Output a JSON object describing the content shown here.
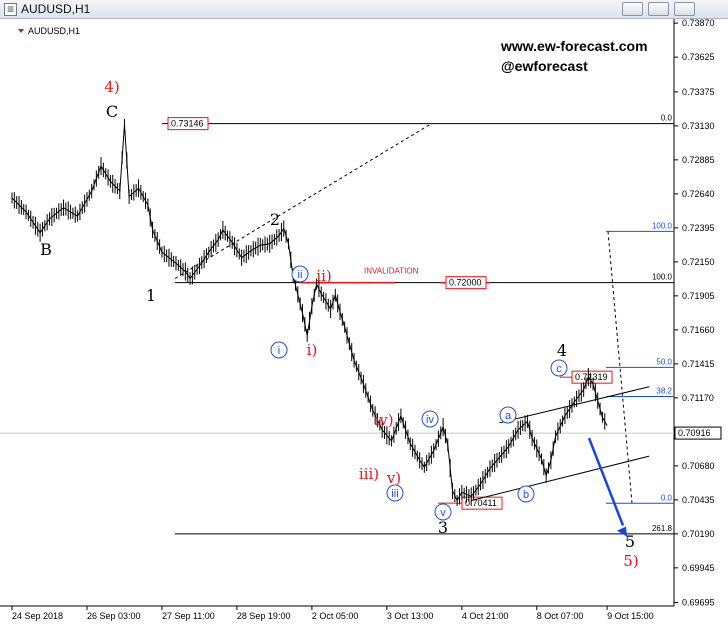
{
  "window": {
    "title": "AUDUSD,H1"
  },
  "chart_data": {
    "type": "line",
    "symbol": "AUDUSD,H1",
    "watermark": [
      "www.ew-forecast.com",
      "@ewforecast"
    ],
    "y_ticks": [
      "0.73870",
      "0.73625",
      "0.73375",
      "0.73130",
      "0.72885",
      "0.72640",
      "0.72395",
      "0.72150",
      "0.71905",
      "0.71660",
      "0.71415",
      "0.71170",
      "0.70925",
      "0.70680",
      "0.70435",
      "0.70190",
      "0.69945",
      "0.69695"
    ],
    "x_ticks": [
      "24 Sep 2018",
      "26 Sep 03:00",
      "27 Sep 11:00",
      "28 Sep 19:00",
      "2 Oct 05:00",
      "3 Oct 13:00",
      "4 Oct 21:00",
      "8 Oct 07:00",
      "9 Oct 15:00"
    ],
    "ylim": [
      0.6967,
      0.739
    ],
    "xlim": [
      0,
      140
    ],
    "price": [
      [
        0,
        0.7261
      ],
      [
        3,
        0.7251
      ],
      [
        6,
        0.7236
      ],
      [
        8,
        0.7246
      ],
      [
        11,
        0.7254
      ],
      [
        14,
        0.7248
      ],
      [
        17,
        0.7266
      ],
      [
        19,
        0.7284
      ],
      [
        21,
        0.7273
      ],
      [
        23,
        0.7266
      ],
      [
        24,
        0.7314
      ],
      [
        25,
        0.7262
      ],
      [
        27,
        0.7268
      ],
      [
        29,
        0.7256
      ],
      [
        30,
        0.7238
      ],
      [
        32,
        0.7222
      ],
      [
        35,
        0.7214
      ],
      [
        37,
        0.7208
      ],
      [
        38,
        0.7203
      ],
      [
        40,
        0.7212
      ],
      [
        42,
        0.7222
      ],
      [
        44,
        0.7231
      ],
      [
        45,
        0.7238
      ],
      [
        47,
        0.7229
      ],
      [
        49,
        0.7218
      ],
      [
        51,
        0.7223
      ],
      [
        53,
        0.7227
      ],
      [
        55,
        0.7228
      ],
      [
        57,
        0.7234
      ],
      [
        58,
        0.7239
      ],
      [
        59,
        0.7228
      ],
      [
        60,
        0.7205
      ],
      [
        62,
        0.7178
      ],
      [
        63,
        0.7162
      ],
      [
        64,
        0.7183
      ],
      [
        65,
        0.7199
      ],
      [
        66,
        0.7192
      ],
      [
        68,
        0.7181
      ],
      [
        69,
        0.7191
      ],
      [
        70,
        0.7179
      ],
      [
        71,
        0.7168
      ],
      [
        73,
        0.7144
      ],
      [
        75,
        0.7127
      ],
      [
        77,
        0.7108
      ],
      [
        79,
        0.7094
      ],
      [
        81,
        0.7086
      ],
      [
        83,
        0.7104
      ],
      [
        84,
        0.7094
      ],
      [
        85,
        0.7084
      ],
      [
        87,
        0.7072
      ],
      [
        88,
        0.7067
      ],
      [
        90,
        0.7079
      ],
      [
        92,
        0.7096
      ],
      [
        93,
        0.7083
      ],
      [
        94,
        0.705
      ],
      [
        95,
        0.7043
      ],
      [
        96,
        0.7049
      ],
      [
        98,
        0.7046
      ],
      [
        100,
        0.7055
      ],
      [
        102,
        0.7066
      ],
      [
        104,
        0.7074
      ],
      [
        106,
        0.7082
      ],
      [
        108,
        0.7094
      ],
      [
        110,
        0.71
      ],
      [
        111,
        0.7088
      ],
      [
        113,
        0.7073
      ],
      [
        114,
        0.7061
      ],
      [
        115,
        0.7072
      ],
      [
        116,
        0.7089
      ],
      [
        118,
        0.7104
      ],
      [
        120,
        0.7114
      ],
      [
        122,
        0.7123
      ],
      [
        123,
        0.7132
      ],
      [
        124,
        0.7127
      ],
      [
        125,
        0.7115
      ],
      [
        126,
        0.7103
      ],
      [
        127,
        0.7097
      ]
    ],
    "current_price": "0.70916",
    "horizontal_levels": [
      {
        "label": "0.73146",
        "value": 0.73146,
        "fib": "0.0"
      },
      {
        "label": "0.72000",
        "value": 0.72,
        "fib": "100.0",
        "note": "INVALIDATION"
      },
      {
        "label": "0.71319",
        "value": 0.71319
      },
      {
        "label": "0.70411",
        "value": 0.70411
      },
      {
        "fib": "261.8",
        "value": 0.7019
      }
    ],
    "fib_right": [
      {
        "label": "100.0",
        "value": 0.7237
      },
      {
        "label": "50.0",
        "value": 0.7139
      },
      {
        "label": "38.2",
        "value": 0.7118
      },
      {
        "label": "0.0",
        "value": 0.7041
      }
    ],
    "wave_labels": {
      "4)": "4)",
      "C": "C",
      "B": "B",
      "2": "2",
      "1": "1",
      "ii_red": "ii)",
      "i_red": "i)",
      "iv_red": "iv)",
      "iii_red": "iii)",
      "v_red": "v)",
      "4": "4",
      "3": "3",
      "5": "5",
      "5)": "5)",
      "ii": "ii",
      "i": "i",
      "iii": "iii",
      "iv": "iv",
      "v": "v",
      "a": "a",
      "b": "b",
      "c": "c"
    },
    "colors": {
      "price": "#000000",
      "red": "#e8141c",
      "blue": "#1f4fd6",
      "arrow": "#1646e0",
      "grid": "#c8c8c8"
    }
  }
}
